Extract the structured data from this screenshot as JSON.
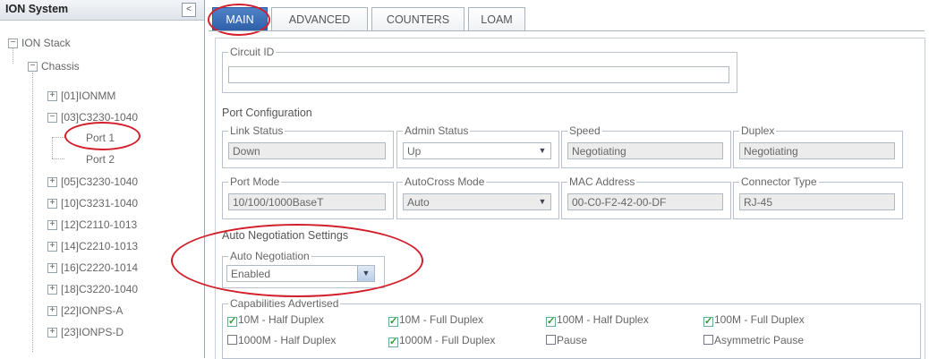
{
  "tree": {
    "title": "ION System",
    "collapse_glyph": "<",
    "root": "ION Stack",
    "chassis": "Chassis",
    "items": [
      "[01]IONMM",
      "[03]C3230-1040",
      "Port 1",
      "Port 2",
      "[05]C3230-1040",
      "[10]C3231-1040",
      "[12]C2110-1013",
      "[14]C2210-1013",
      "[16]C2220-1014",
      "[18]C3220-1040",
      "[22]IONPS-A",
      "[23]IONPS-D"
    ]
  },
  "tabs": [
    "MAIN",
    "ADVANCED",
    "COUNTERS",
    "LOAM"
  ],
  "circuit": {
    "legend": "Circuit ID",
    "value": ""
  },
  "port_config": {
    "title": "Port Configuration",
    "link_status": {
      "label": "Link Status",
      "value": "Down"
    },
    "admin_status": {
      "label": "Admin Status",
      "value": "Up"
    },
    "speed": {
      "label": "Speed",
      "value": "Negotiating"
    },
    "duplex": {
      "label": "Duplex",
      "value": "Negotiating"
    },
    "port_mode": {
      "label": "Port Mode",
      "value": "10/100/1000BaseT"
    },
    "autocross": {
      "label": "AutoCross Mode",
      "value": "Auto"
    },
    "mac": {
      "label": "MAC Address",
      "value": "00-C0-F2-42-00-DF"
    },
    "connector": {
      "label": "Connector Type",
      "value": "RJ-45"
    }
  },
  "auto_neg": {
    "title": "Auto Negotiation Settings",
    "label": "Auto Negotiation",
    "value": "Enabled"
  },
  "capabilities": {
    "legend": "Capabilities Advertised",
    "items": [
      {
        "label": "10M - Half Duplex",
        "checked": true
      },
      {
        "label": "10M - Full Duplex",
        "checked": true
      },
      {
        "label": "100M - Half Duplex",
        "checked": true
      },
      {
        "label": "100M - Full Duplex",
        "checked": true
      },
      {
        "label": "1000M - Half Duplex",
        "checked": false
      },
      {
        "label": "1000M - Full Duplex",
        "checked": true
      },
      {
        "label": "Pause",
        "checked": false
      },
      {
        "label": "Asymmetric Pause",
        "checked": false
      }
    ]
  },
  "colors": {
    "accent": "#2c5fa8",
    "annotation": "#d21f2b",
    "check": "#2f9a2f"
  }
}
